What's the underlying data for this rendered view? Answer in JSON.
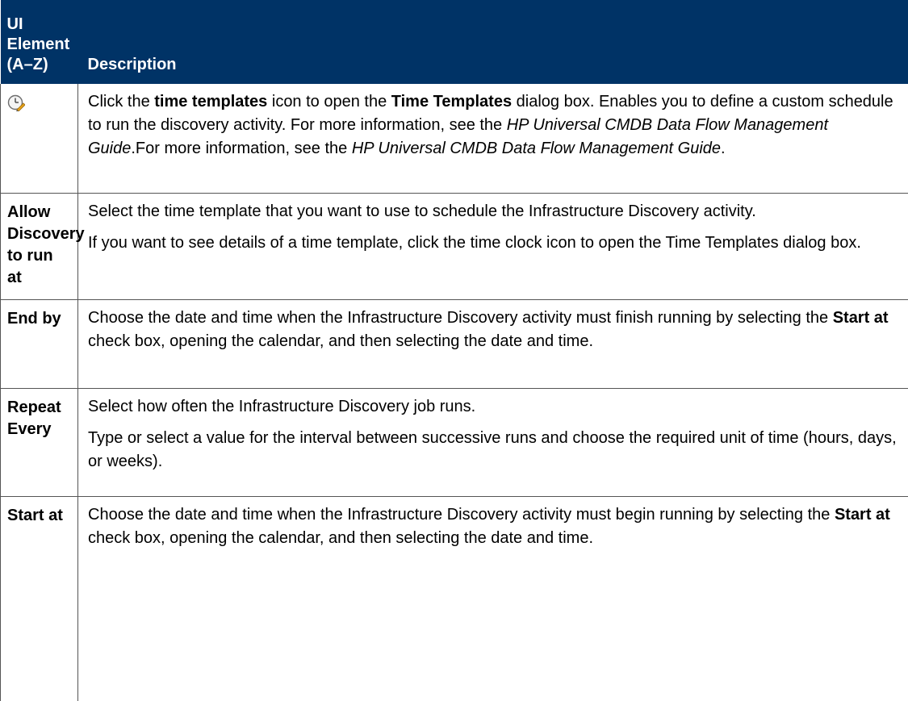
{
  "header": {
    "col1_line1": "UI",
    "col1_line2": "Element",
    "col1_line3": "(A–Z)",
    "col2": "Description"
  },
  "rows": [
    {
      "icon": "time-templates-icon",
      "desc": {
        "p1_a": "Click the ",
        "p1_b": "time templates",
        "p1_c": " icon to open the ",
        "p1_d": "Time Templates",
        "p1_e": " dialog box. Enables you to define a custom schedule to run the discovery activity. For more information, see the ",
        "p1_f": "HP Universal CMDB Data Flow Management Guide",
        "p1_g": ".For more information, see the ",
        "p1_h": "HP Universal CMDB Data Flow Management Guide",
        "p1_i": "."
      }
    },
    {
      "element": "Allow Discovery to run at",
      "desc": {
        "p1": "Select the time template that you want to use to schedule the Infrastructure Discovery activity.",
        "p2": "If you want to see details of a time template, click the time clock icon to open the Time Templates dialog box."
      }
    },
    {
      "element": "End by",
      "desc": {
        "p1_a": "Choose the date and time when the Infrastructure Discovery activity must finish running by selecting the ",
        "p1_b": "Start at",
        "p1_c": " check box, opening the calendar, and then selecting the date and time."
      }
    },
    {
      "element": "Repeat Every",
      "desc": {
        "p1": "Select how often the Infrastructure Discovery job runs.",
        "p2": "Type or select a value for the interval between successive runs and choose the required unit of time (hours, days, or weeks)."
      }
    },
    {
      "element": "Start at",
      "desc": {
        "p1_a": "Choose the date and time when the Infrastructure Discovery activity must begin running by selecting the ",
        "p1_b": "Start at",
        "p1_c": " check box, opening the calendar, and then selecting the date and time."
      }
    }
  ],
  "colors": {
    "header_bg": "#003366",
    "header_text": "#ffffff",
    "border": "#555555"
  }
}
